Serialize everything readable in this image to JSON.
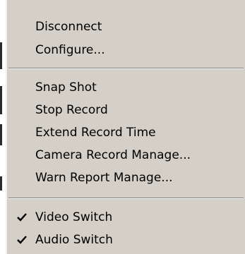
{
  "menu": {
    "groups": [
      {
        "items": [
          {
            "label": "Disconnect",
            "checked": false
          },
          {
            "label": "Configure...",
            "checked": false
          }
        ]
      },
      {
        "items": [
          {
            "label": "Snap Shot",
            "checked": false
          },
          {
            "label": "Stop Record",
            "checked": false
          },
          {
            "label": "Extend Record Time",
            "checked": false
          },
          {
            "label": "Camera Record Manage...",
            "checked": false
          },
          {
            "label": "Warn Report Manage...",
            "checked": false
          }
        ]
      },
      {
        "items": [
          {
            "label": "Video Switch",
            "checked": true,
            "icon": "checkmark-icon"
          },
          {
            "label": "Audio Switch",
            "checked": true,
            "icon": "checkmark-icon"
          }
        ]
      }
    ]
  },
  "colors": {
    "menu_background": "#d4d0c8",
    "separator_dark": "#808080",
    "separator_light": "#ffffff",
    "text": "#000000"
  }
}
